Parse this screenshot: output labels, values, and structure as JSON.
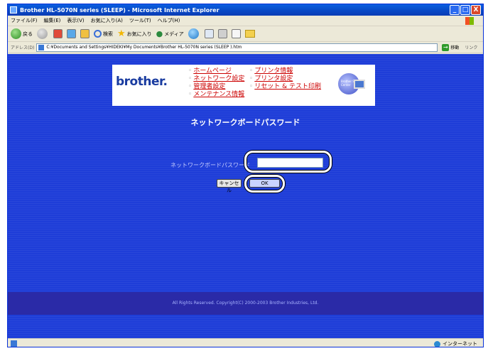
{
  "window": {
    "title": "Brother HL-5070N series (SLEEP) - Microsoft Internet Explorer",
    "controls": [
      "_",
      "□",
      "X"
    ]
  },
  "menubar": [
    "ファイル(F)",
    "編集(E)",
    "表示(V)",
    "お気に入り(A)",
    "ツール(T)",
    "ヘルプ(H)"
  ],
  "toolbar": {
    "back_label": "戻る",
    "search_label": "検索",
    "favorites_label": "お気に入り",
    "media_label": "メディア"
  },
  "address": {
    "label": "アドレス(D)",
    "url": "C:¥Documents and Settings¥HIDEKI¥My Documents¥Brother HL-5070N series (SLEEP ).htm",
    "go_label": "移動",
    "links_label": "リンク"
  },
  "brand": "brother.",
  "nav": {
    "col1": [
      "ホームページ",
      "ネットワーク設定",
      "管理者設定",
      "メンテナンス情報"
    ],
    "col2": [
      "プリンタ情報",
      "プリンタ設定",
      "リセット & テスト印刷"
    ]
  },
  "solutions_badge": "Brother Solutions Center",
  "page": {
    "heading": "ネットワークボードパスワード",
    "password_label": "ネットワークボードパスワード",
    "password_value": "",
    "cancel_label": "キャンセル",
    "ok_label": "OK"
  },
  "footer": {
    "copyright": "All Rights Reserved. Copyright(C) 2000-2003 Brother Industries, Ltd."
  },
  "status": {
    "zone": "インターネット"
  }
}
